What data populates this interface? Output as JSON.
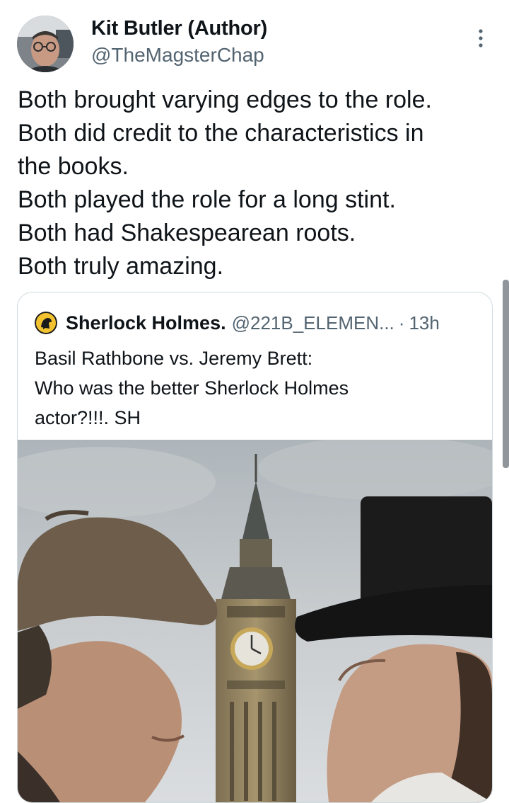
{
  "tweet": {
    "author": {
      "display_name": "Kit Butler (Author)",
      "handle": "@TheMagsterChap"
    },
    "text_lines": [
      "Both brought varying edges to the role.",
      "Both did credit to the characteristics in",
      "the books.",
      "Both played the role for a long stint.",
      "Both had Shakespearean roots.",
      "Both truly amazing."
    ],
    "more_icon": "more-vertical-icon"
  },
  "quoted_tweet": {
    "author": {
      "display_name": "Sherlock Holmes.",
      "handle": "@221B_ELEMEN...",
      "separator": "·",
      "time": "13h"
    },
    "text_lines": [
      "Basil Rathbone vs. Jeremy Brett:",
      "Who was the better Sherlock Holmes",
      "actor?!!!. SH"
    ]
  },
  "colors": {
    "text_primary": "#0f1419",
    "text_secondary": "#536471",
    "border": "#cfd9de"
  }
}
